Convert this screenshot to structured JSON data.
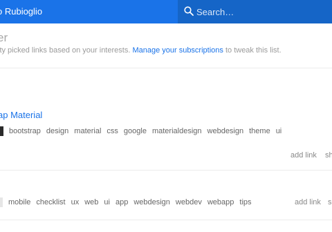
{
  "header": {
    "user_name": "o Rubioglio",
    "search_placeholder": "Search…"
  },
  "intro": {
    "heading": "er",
    "subtitle_prefix": "ity picked links based on your interests. ",
    "subtitle_link": "Manage your subscriptions",
    "subtitle_suffix": " to tweak this list."
  },
  "cards": [
    {
      "title": "ap Material",
      "tags": [
        "bootstrap",
        "design",
        "material",
        "css",
        "google",
        "materialdesign",
        "webdesign",
        "theme",
        "ui"
      ],
      "add_link": "add link",
      "share": "sh"
    },
    {
      "tags": [
        "mobile",
        "checklist",
        "ux",
        "web",
        "ui",
        "app",
        "webdesign",
        "webdev",
        "webapp",
        "tips"
      ],
      "add_link": "add link",
      "share": "s"
    }
  ]
}
